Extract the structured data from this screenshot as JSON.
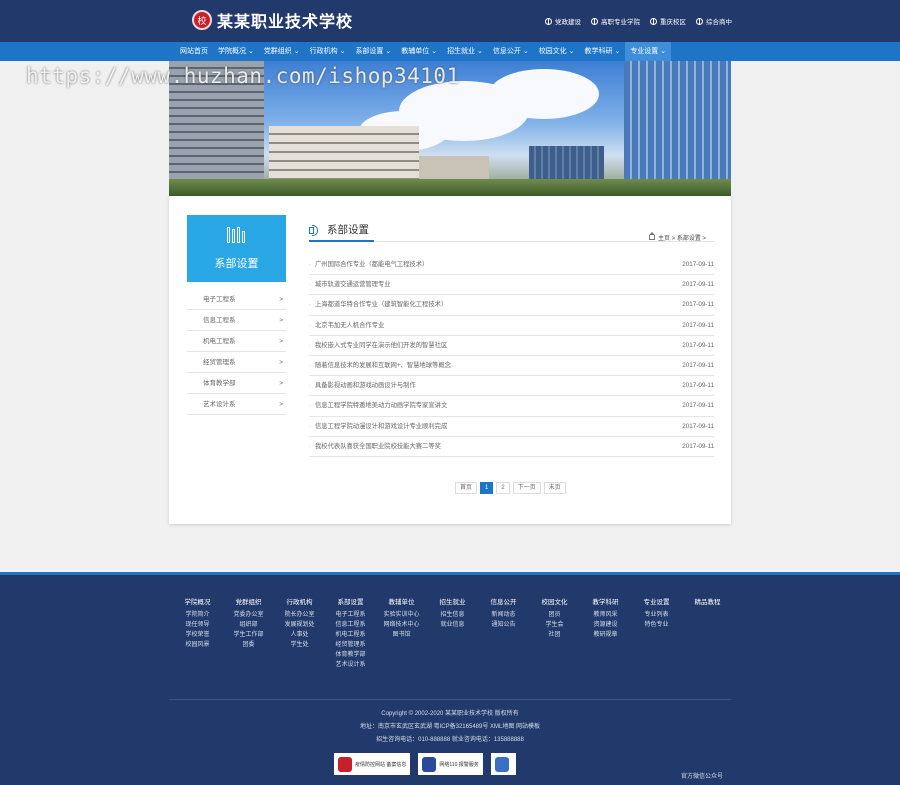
{
  "header": {
    "logo_mark": "校",
    "school_name": "某某职业技术学校",
    "quick_links": [
      "党政建设",
      "高职专业学院",
      "重庆校区",
      "综合商中"
    ]
  },
  "nav": {
    "items": [
      "网站首页",
      "学院概况 ⌄",
      "党群组织 ⌄",
      "行政机构 ⌄",
      "系部设置 ⌄",
      "教辅单位 ⌄",
      "招生就业 ⌄",
      "信息公开 ⌄",
      "校园文化 ⌄",
      "教学科研 ⌄",
      "专业设置 ⌄"
    ],
    "active_index": 10
  },
  "watermark": "https://www.huzhan.com/ishop34101",
  "sidebar": {
    "title": "系部设置",
    "items": [
      "电子工程系",
      "信息工程系",
      "机电工程系",
      "经贸管理系",
      "体育教学部",
      "艺术设计系"
    ],
    "arrow": ">"
  },
  "section": {
    "title": "系部设置",
    "breadcrumb": "主页 > 系部设置 >"
  },
  "news": [
    {
      "title": "广州国际合作专业（都能电气工程技术）",
      "date": "2017-09-11"
    },
    {
      "title": "城市轨道交通运营管理专业",
      "date": "2017-09-11"
    },
    {
      "title": "上海都道华特合作专业（建筑智能化工程技术）",
      "date": "2017-09-11"
    },
    {
      "title": "北京韦加无人机合作专业",
      "date": "2017-09-11"
    },
    {
      "title": "我校嵌入式专业同学在演示他们开发的智慧社区",
      "date": "2017-09-11"
    },
    {
      "title": "随着信息技术的发展和互联网+、智慧地球等概念",
      "date": "2017-09-11"
    },
    {
      "title": "具备影视动画和游戏动画设计与制作",
      "date": "2017-09-11"
    },
    {
      "title": "信息工程学院特邀地美动力动画学院专家宣讲文",
      "date": "2017-09-11"
    },
    {
      "title": "信息工程学院动漫设计和游戏设计专业顺利完成",
      "date": "2017-09-11"
    },
    {
      "title": "我校代表队喜获全国职业院校技能大赛二等奖",
      "date": "2017-09-11"
    }
  ],
  "pager": {
    "first": "首页",
    "pages": [
      "1",
      "2"
    ],
    "current": "1",
    "next": "下一页",
    "last": "末页"
  },
  "footer": {
    "columns": [
      {
        "title": "学院概况",
        "links": [
          "学院简介",
          "现任领导",
          "学校荣誉",
          "校园风景"
        ]
      },
      {
        "title": "党群组织",
        "links": [
          "党委办公室",
          "组织部",
          "学生工作部",
          "团委"
        ]
      },
      {
        "title": "行政机构",
        "links": [
          "院长办公室",
          "发展规划处",
          "人事处",
          "学生处"
        ]
      },
      {
        "title": "系部设置",
        "links": [
          "电子工程系",
          "信息工程系",
          "机电工程系",
          "经贸管理系",
          "体育教学部",
          "艺术设计系"
        ]
      },
      {
        "title": "教辅单位",
        "links": [
          "实验实训中心",
          "网络技术中心",
          "图书馆"
        ]
      },
      {
        "title": "招生就业",
        "links": [
          "招生信息",
          "就业信息"
        ]
      },
      {
        "title": "信息公开",
        "links": [
          "新闻动态",
          "通知公告"
        ]
      },
      {
        "title": "校园文化",
        "links": [
          "团员",
          "学生会",
          "社团"
        ]
      },
      {
        "title": "教学科研",
        "links": [
          "教师风采",
          "资源建设",
          "教研规章"
        ]
      },
      {
        "title": "专业设置",
        "links": [
          "专业列表",
          "特色专业"
        ]
      },
      {
        "title": "精品教程",
        "links": []
      }
    ],
    "copyright": "Copyright © 2002-2020 某某职业技术学校 版权所有",
    "address": "地址：南京市玄武区玄武湖 粤ICP备32165489号 XML地图 网站模板",
    "phones": "招生咨询电话：010-888888 就业咨询电话：135888888",
    "badges": [
      "疫情防控网站 备案信息",
      "网络110 报警服务",
      ""
    ],
    "wechat": "官方微信公众号"
  },
  "colors": {
    "header_bg": "#223a6b",
    "nav_bg": "#1e75c8",
    "side_head_bg": "#2aa8e5",
    "accent": "#1e75c8"
  }
}
